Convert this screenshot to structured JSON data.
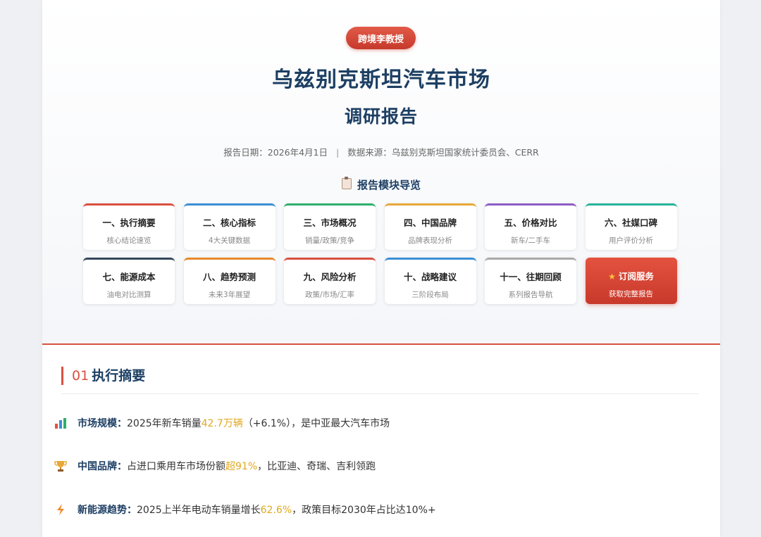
{
  "badge": "跨境李教授",
  "title": "乌兹别克斯坦汽车市场",
  "subtitle": "调研报告",
  "meta": {
    "date": "报告日期：2026年4月1日",
    "separator": "|",
    "source": "数据来源：乌兹别克斯坦国家统计委员会、CERR"
  },
  "nav": {
    "title": "报告模块导览",
    "cards": [
      {
        "title": "一、执行摘要",
        "sub": "核心结论速览",
        "color": "#d9503f"
      },
      {
        "title": "二、核心指标",
        "sub": "4大关键数据",
        "color": "#3a8fd6"
      },
      {
        "title": "三、市场概况",
        "sub": "销量/政策/竞争",
        "color": "#2fae6b"
      },
      {
        "title": "四、中国品牌",
        "sub": "品牌表现分析",
        "color": "#e8a838"
      },
      {
        "title": "五、价格对比",
        "sub": "新车/二手车",
        "color": "#8e5cc4"
      },
      {
        "title": "六、社媒口碑",
        "sub": "用户评价分析",
        "color": "#25b39a"
      },
      {
        "title": "七、能源成本",
        "sub": "油电对比测算",
        "color": "#35475c"
      },
      {
        "title": "八、趋势预测",
        "sub": "未来3年展望",
        "color": "#e8892a"
      },
      {
        "title": "九、风险分析",
        "sub": "政策/市场/汇率",
        "color": "#d9503f"
      },
      {
        "title": "十、战略建议",
        "sub": "三阶段布局",
        "color": "#3a8fd6"
      },
      {
        "title": "十一、往期回顾",
        "sub": "系列报告导航",
        "color": "#a9a9a9"
      },
      {
        "title": "订阅服务",
        "sub": "获取完整报告",
        "color": "#d9503f",
        "cta": true
      }
    ]
  },
  "section": {
    "num": "01",
    "title": "执行摘要",
    "items": [
      {
        "icon": "bar-chart-icon",
        "label": "市场规模：",
        "pre": "2025年新车销量",
        "hl": "42.7万辆",
        "post": "（+6.1%），是中亚最大汽车市场"
      },
      {
        "icon": "trophy-icon",
        "label": "中国品牌：",
        "pre": "占进口乘用车市场份额",
        "hl": "超91%",
        "post": "，比亚迪、奇瑞、吉利领跑"
      },
      {
        "icon": "lightning-icon",
        "label": "新能源趋势：",
        "pre": "2025上半年电动车销量增长",
        "hl": "62.6%",
        "post": "，政策目标2030年占比达10%+"
      }
    ]
  }
}
